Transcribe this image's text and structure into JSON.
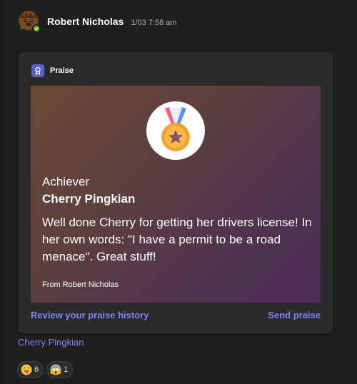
{
  "message": {
    "sender_name": "Robert Nicholas",
    "timestamp": "1/03 7:58 am",
    "avatar_icon": "beaver-avatar-icon",
    "status": "available"
  },
  "card": {
    "label": "Praise",
    "badge_name": "Achiever",
    "recipient": "Cherry Pingkian",
    "message": "Well done Cherry for getting her drivers license! In her own words: \"I have a permit to be a road menace\". Great stuff!",
    "from": "From Robert Nicholas",
    "review_link": "Review your praise history",
    "send_link": "Send praise"
  },
  "mention": "Cherry Pingkian",
  "reactions": [
    {
      "icon": "tongue-out-emoji-icon",
      "count": "6"
    },
    {
      "icon": "screaming-face-emoji-icon",
      "count": "1"
    }
  ],
  "colors": {
    "background": "#1f1f1f",
    "card": "#2b2b2b",
    "link": "#7f85f5",
    "praise_icon": "#5b5fc7",
    "status_available": "#6bb700"
  }
}
